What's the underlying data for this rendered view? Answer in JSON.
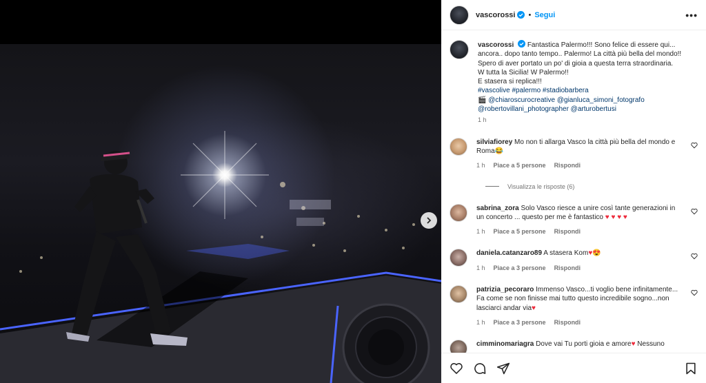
{
  "post": {
    "username": "vascorossi",
    "follow_label": "Segui",
    "dot": "•",
    "more_label": "•••",
    "caption": {
      "username": "vascorossi",
      "line1": "Fantastica Palermo!!! Sono felice di essere qui... ancora.. dopo tanto tempo.. Palermo! La città più bella del mondo!!",
      "line2": "Spero di aver portato un po' di gioia a questa terra straordinaria.",
      "line3": "W tutta la Sicilia! W Palermo!!",
      "line4": "E stasera si replica!!!",
      "hashtags": "#vascolive #palermo #stadiobarbera",
      "camera": "🎬",
      "mentions1": "@chiaroscurocreative @gianluca_simoni_fotografo",
      "mentions2": "@robertovillani_photographer @arturobertusi",
      "time": "1 h"
    }
  },
  "comments": [
    {
      "username": "silviafiorey",
      "text": "Mo non ti allarga Vasco la città più bella del mondo e Roma😂",
      "time": "1 h",
      "likes": "Piace a 5 persone",
      "reply": "Rispondi",
      "view_replies": "Visualizza le risposte (6)"
    },
    {
      "username": "sabrina_zora",
      "text": "Solo Vasco riesce a unire così tante generazioni in un concerto ... questo per me è fantastico ",
      "hearts": "♥ ♥ ♥ ♥",
      "time": "1 h",
      "likes": "Piace a 5 persone",
      "reply": "Rispondi"
    },
    {
      "username": "daniela.catanzaro89",
      "text": "A stasera Kom",
      "hearts": "♥",
      "emoji": "😍",
      "time": "1 h",
      "likes": "Piace a 3 persone",
      "reply": "Rispondi"
    },
    {
      "username": "patrizia_pecoraro",
      "text": "Immenso Vasco...ti voglio bene infinitamente... Fa come se non finisse mai tutto questo incredibile sogno...non lasciarci andar via",
      "hearts": "♥",
      "time": "1 h",
      "likes": "Piace a 3 persone",
      "reply": "Rispondi"
    },
    {
      "username": "cimminomariagra",
      "text": "Dove vai Tu porti gioia e amore",
      "hearts": "♥",
      "tail": "Nessuno"
    }
  ],
  "icons": {
    "verified": "verified-badge-icon",
    "like": "heart-icon",
    "comment": "comment-icon",
    "share": "send-icon",
    "save": "bookmark-icon",
    "next": "chevron-right-icon"
  },
  "colors": {
    "accent": "#0095f6",
    "heart_red": "#ed2a3b",
    "tag_blue": "#00376b",
    "muted": "#737373"
  }
}
